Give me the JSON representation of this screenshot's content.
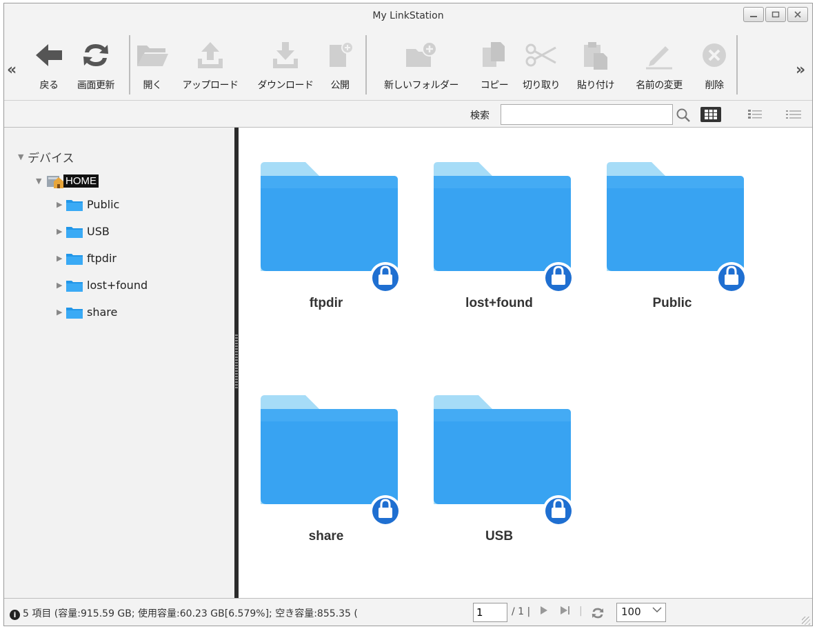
{
  "window": {
    "title": "My LinkStation",
    "controls": [
      "minimize",
      "maximize",
      "close"
    ]
  },
  "toolbar": {
    "scroll_left": "«",
    "scroll_right": "»",
    "buttons": [
      {
        "label": "戻る",
        "icon": "back-arrow-icon"
      },
      {
        "label": "画面更新",
        "icon": "refresh-icon"
      },
      {
        "label": "開く",
        "icon": "open-folder-icon"
      },
      {
        "label": "アップロード",
        "icon": "upload-icon"
      },
      {
        "label": "ダウンロード",
        "icon": "download-icon"
      },
      {
        "label": "公開",
        "icon": "publish-icon"
      },
      {
        "label": "新しいフォルダー",
        "icon": "new-folder-icon"
      },
      {
        "label": "コピー",
        "icon": "copy-icon"
      },
      {
        "label": "切り取り",
        "icon": "cut-icon"
      },
      {
        "label": "貼り付け",
        "icon": "paste-icon"
      },
      {
        "label": "名前の変更",
        "icon": "rename-icon"
      },
      {
        "label": "削除",
        "icon": "delete-icon"
      }
    ]
  },
  "search": {
    "label": "検索",
    "value": "",
    "placeholder": ""
  },
  "view_modes": [
    "large-icons",
    "details",
    "list"
  ],
  "tree": {
    "root_label": "デバイス",
    "home_label": "HOME",
    "children": [
      "Public",
      "USB",
      "ftpdir",
      "lost+found",
      "share"
    ]
  },
  "folders": [
    {
      "name": "ftpdir",
      "locked": true
    },
    {
      "name": "lost+found",
      "locked": true
    },
    {
      "name": "Public",
      "locked": true
    },
    {
      "name": "share",
      "locked": true
    },
    {
      "name": "USB",
      "locked": true
    }
  ],
  "status": {
    "summary": "5 項目 (容量:915.59 GB; 使用容量:60.23 GB[6.579%]; 空き容量:855.35 (",
    "page_value": "1",
    "page_total": "/ 1 |",
    "page_size": "100"
  },
  "colors": {
    "folder_front": "#38a3f2",
    "folder_back": "#a6dcf7",
    "lock_badge": "#1f6fd1"
  }
}
